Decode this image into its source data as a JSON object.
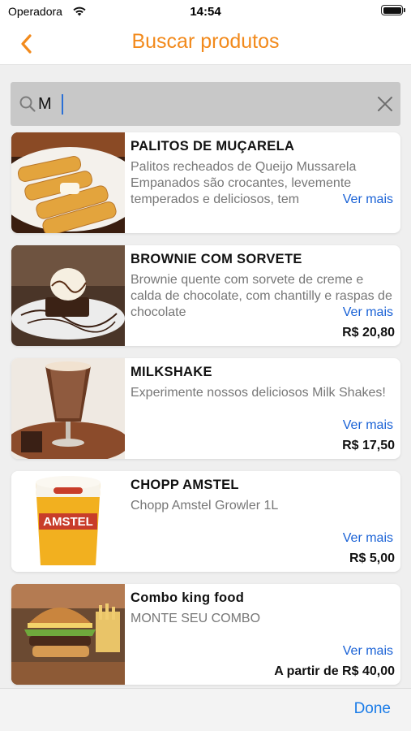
{
  "status_bar": {
    "carrier": "Operadora",
    "time": "14:54",
    "wifi_icon": "wifi-icon",
    "battery_icon": "battery-icon"
  },
  "nav": {
    "title": "Buscar produtos",
    "back_icon": "chevron-left-icon"
  },
  "search": {
    "value": "M",
    "search_icon": "magnifier-icon",
    "clear_icon": "close-icon"
  },
  "products": [
    {
      "title": "PALITOS DE MUÇARELA",
      "description": "Palitos recheados de Queijo Mussarela Empanados são crocantes, levemente temperados e deliciosos, tem",
      "more": "Ver mais",
      "price": ""
    },
    {
      "title": "BROWNIE COM SORVETE",
      "description": "Brownie quente com sorvete de creme e calda de chocolate, com chantilly e raspas de chocolate",
      "more": "Ver mais",
      "price": "R$ 20,80"
    },
    {
      "title": "MILKSHAKE",
      "description": "Experimente nossos deliciosos Milk Shakes!",
      "more": "Ver mais",
      "price": "R$ 17,50"
    },
    {
      "title": "CHOPP AMSTEL",
      "description": "Chopp Amstel Growler 1L",
      "more": "Ver mais",
      "price": "R$ 5,00",
      "brand_label": "AMSTEL"
    },
    {
      "title": "Combo king food",
      "description": "MONTE SEU COMBO",
      "more": "Ver mais",
      "price": "A partir de R$ 40,00"
    }
  ],
  "toolbar": {
    "done": "Done"
  },
  "colors": {
    "accent": "#f28a1c",
    "link": "#1a62d6",
    "done": "#1a7ce8",
    "search_bg": "#c8c8c8"
  }
}
